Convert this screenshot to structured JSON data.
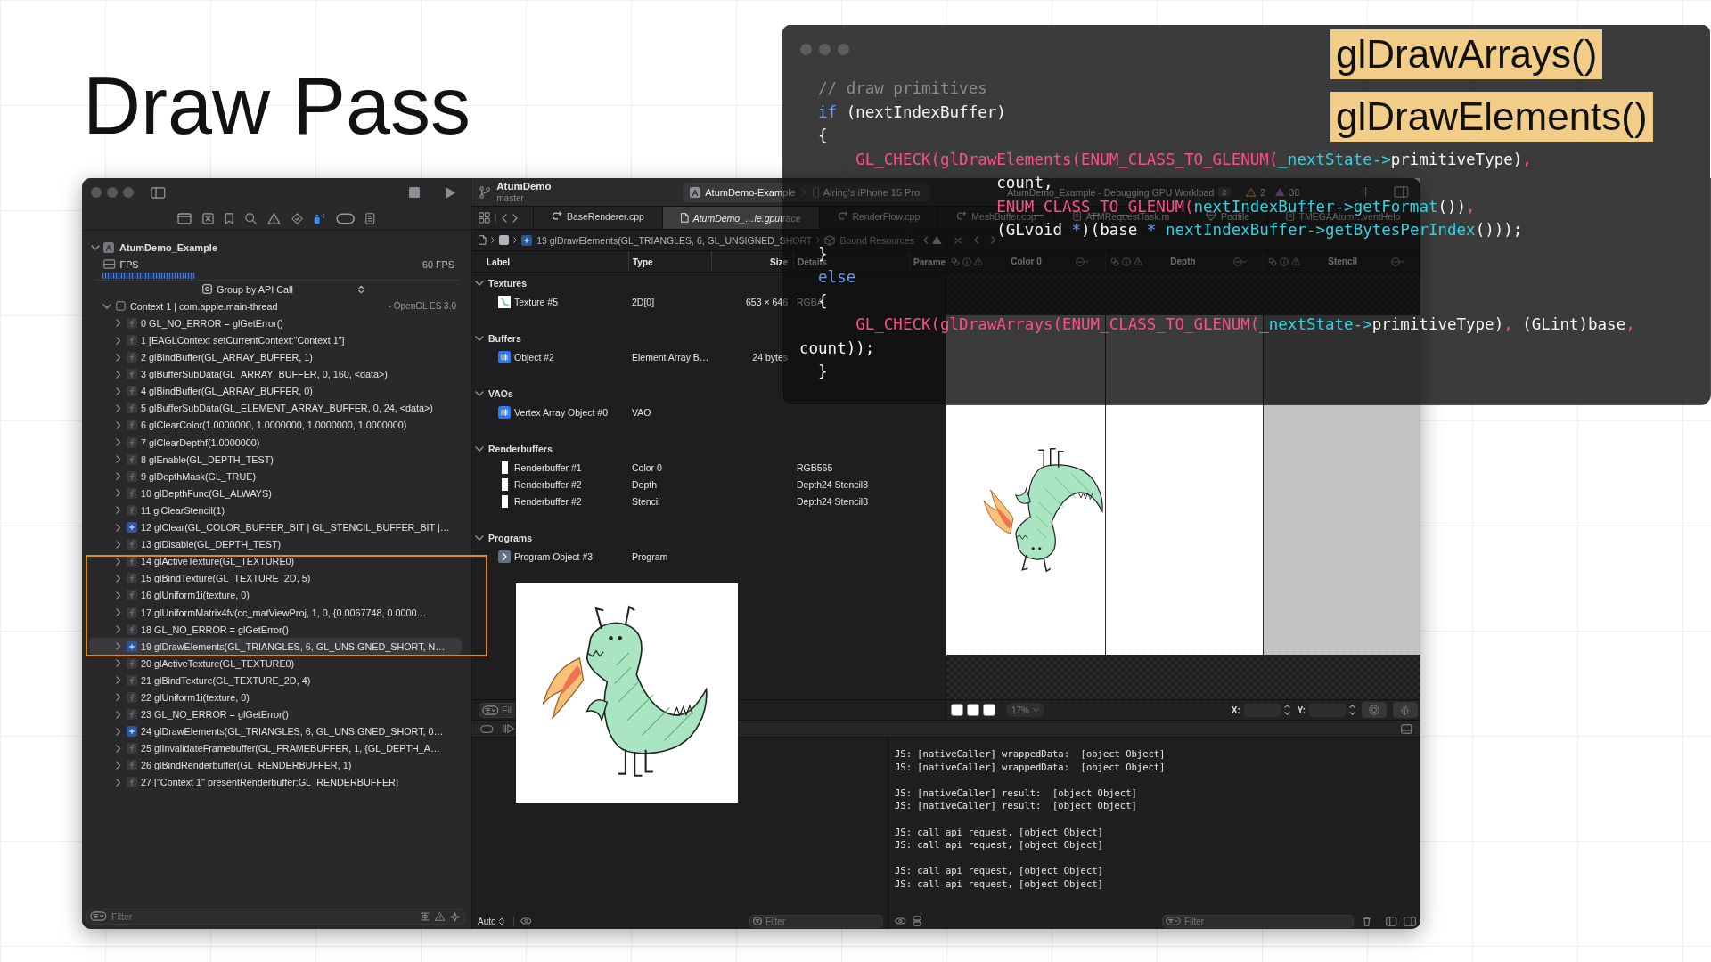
{
  "slide": {
    "title": "Draw Pass"
  },
  "navigator": {
    "toolbar": [
      {
        "kind": "project",
        "selected": false
      },
      {
        "kind": "source",
        "selected": false
      },
      {
        "kind": "bookmark",
        "selected": false
      },
      {
        "kind": "find",
        "selected": false
      },
      {
        "kind": "issue",
        "selected": false
      },
      {
        "kind": "test",
        "selected": false
      },
      {
        "kind": "debug",
        "selected": true
      },
      {
        "kind": "breakpoint",
        "selected": false
      },
      {
        "kind": "report",
        "selected": false
      }
    ],
    "app": {
      "name": "AtumDemo_Example",
      "expanded": true
    },
    "fps": {
      "label": "FPS",
      "value": "60 FPS"
    },
    "grouping": "Group by API Call",
    "context": {
      "name": "Context 1 | com.apple.main-thread",
      "api": "- OpenGL ES 3.0",
      "expanded": true
    },
    "calls": [
      {
        "text": "0 GL_NO_ERROR = glGetError()",
        "kind": "call",
        "expanded": false,
        "selected": false
      },
      {
        "text": "1 [EAGLContext setCurrentContext:\"Context 1\"]",
        "kind": "call",
        "expanded": false,
        "selected": false
      },
      {
        "text": "2 glBindBuffer(GL_ARRAY_BUFFER, 1)",
        "kind": "call",
        "expanded": false,
        "selected": false
      },
      {
        "text": "3 glBufferSubData(GL_ARRAY_BUFFER, 0, 160, <data>)",
        "kind": "call",
        "expanded": false,
        "selected": false
      },
      {
        "text": "4 glBindBuffer(GL_ARRAY_BUFFER, 0)",
        "kind": "call",
        "expanded": false,
        "selected": false
      },
      {
        "text": "5 glBufferSubData(GL_ELEMENT_ARRAY_BUFFER, 0, 24, <data>)",
        "kind": "call",
        "expanded": false,
        "selected": false
      },
      {
        "text": "6 glClearColor(1.0000000, 1.0000000, 1.0000000, 1.0000000)",
        "kind": "call",
        "expanded": false,
        "selected": false
      },
      {
        "text": "7 glClearDepthf(1.0000000)",
        "kind": "call",
        "expanded": false,
        "selected": false
      },
      {
        "text": "8 glEnable(GL_DEPTH_TEST)",
        "kind": "call",
        "expanded": false,
        "selected": false
      },
      {
        "text": "9 glDepthMask(GL_TRUE)",
        "kind": "call",
        "expanded": false,
        "selected": false
      },
      {
        "text": "10 glDepthFunc(GL_ALWAYS)",
        "kind": "call",
        "expanded": false,
        "selected": false
      },
      {
        "text": "11 glClearStencil(1)",
        "kind": "call",
        "expanded": false,
        "selected": false
      },
      {
        "text": "12 glClear(GL_COLOR_BUFFER_BIT | GL_STENCIL_BUFFER_BIT |…",
        "kind": "draw",
        "expanded": false,
        "selected": false
      },
      {
        "text": "13 glDisable(GL_DEPTH_TEST)",
        "kind": "call",
        "expanded": false,
        "selected": false
      },
      {
        "text": "14 glActiveTexture(GL_TEXTURE0)",
        "kind": "call",
        "expanded": false,
        "selected": false
      },
      {
        "text": "15 glBindTexture(GL_TEXTURE_2D, 5)",
        "kind": "call",
        "expanded": false,
        "selected": false
      },
      {
        "text": "16 glUniform1i(texture, 0)",
        "kind": "call",
        "expanded": false,
        "selected": false
      },
      {
        "text": "17 glUniformMatrix4fv(cc_matViewProj, 1, 0, {0.0067748, 0.0000…",
        "kind": "call",
        "expanded": false,
        "selected": false
      },
      {
        "text": "18 GL_NO_ERROR = glGetError()",
        "kind": "call",
        "expanded": false,
        "selected": false
      },
      {
        "text": "19 glDrawElements(GL_TRIANGLES, 6, GL_UNSIGNED_SHORT, N…",
        "kind": "draw",
        "expanded": false,
        "selected": true
      },
      {
        "text": "20 glActiveTexture(GL_TEXTURE0)",
        "kind": "call",
        "expanded": false,
        "selected": false
      },
      {
        "text": "21 glBindTexture(GL_TEXTURE_2D, 4)",
        "kind": "call",
        "expanded": false,
        "selected": false
      },
      {
        "text": "22 glUniform1i(texture, 0)",
        "kind": "call",
        "expanded": false,
        "selected": false
      },
      {
        "text": "23 GL_NO_ERROR = glGetError()",
        "kind": "call",
        "expanded": false,
        "selected": false
      },
      {
        "text": "24 glDrawElements(GL_TRIANGLES, 6, GL_UNSIGNED_SHORT, 0…",
        "kind": "draw",
        "expanded": false,
        "selected": false
      },
      {
        "text": "25 glInvalidateFramebuffer(GL_FRAMEBUFFER, 1, {GL_DEPTH_A…",
        "kind": "call",
        "expanded": false,
        "selected": false
      },
      {
        "text": "26 glBindRenderbuffer(GL_RENDERBUFFER, 1)",
        "kind": "call",
        "expanded": false,
        "selected": false
      },
      {
        "text": "27 [\"Context 1\" presentRenderbuffer:GL_RENDERBUFFER]",
        "kind": "call",
        "expanded": false,
        "selected": false
      }
    ],
    "filter": {
      "placeholder": "Filter"
    }
  },
  "toolbar": {
    "project": "AtumDemo",
    "branch": "master",
    "scheme": "AtumDemo-Example",
    "device": "Airing's iPhone 15 Pro",
    "activity": "AtumDemo_Example - Debugging GPU Workload",
    "activity_count": "2",
    "warnings": "2",
    "issues": "38"
  },
  "tabs": [
    {
      "label": "BaseRenderer.cpp",
      "kind": "cpp",
      "selected": false
    },
    {
      "label": "AtumDemo_…le.gputrace",
      "kind": "trace",
      "selected": true
    },
    {
      "label": "RenderFlow.cpp",
      "kind": "cpp",
      "selected": false
    },
    {
      "label": "MeshBuffer.cpp",
      "kind": "cpp",
      "selected": false
    },
    {
      "label": "ATMRequestTask.m",
      "kind": "objc",
      "selected": false
    },
    {
      "label": "Podfile",
      "kind": "pod",
      "selected": false
    },
    {
      "label": "TMEGAAtum…ventHelp",
      "kind": "header",
      "selected": false
    }
  ],
  "resources": {
    "breadcrumb": [
      {
        "kind": "file"
      },
      {
        "kind": "frame"
      },
      {
        "kind": "draw",
        "text": "19 glDrawElements(GL_TRIANGLES, 6, GL_UNSIGNED_SHORT"
      },
      {
        "kind": "resources",
        "text": "Bound Resources"
      }
    ],
    "columns": [
      "Label",
      "Type",
      "Size",
      "Details",
      "Parame"
    ],
    "sections": [
      {
        "title": "Textures",
        "expanded": true,
        "rows": [
          {
            "kind": "texture",
            "label": "Texture #5",
            "type": "2D[0]",
            "size": "653 × 646",
            "details": "RGBA"
          }
        ]
      },
      {
        "title": "Buffers",
        "expanded": true,
        "rows": [
          {
            "kind": "buffer",
            "label": "Object #2",
            "type": "Element Array B…",
            "size": "24 bytes"
          }
        ]
      },
      {
        "title": "VAOs",
        "expanded": true,
        "rows": [
          {
            "kind": "vao",
            "label": "Vertex Array Object #0",
            "type": "VAO"
          }
        ]
      },
      {
        "title": "Renderbuffers",
        "expanded": true,
        "rows": [
          {
            "kind": "renderbuffer",
            "label": "Renderbuffer #1",
            "type": "Color 0",
            "details": "RGB565"
          },
          {
            "kind": "renderbuffer",
            "label": "Renderbuffer #2",
            "type": "Depth",
            "details": "Depth24 Stencil8"
          },
          {
            "kind": "renderbuffer",
            "label": "Renderbuffer #2",
            "type": "Stencil",
            "details": "Depth24 Stencil8"
          }
        ]
      },
      {
        "title": "Programs",
        "expanded": true,
        "rows": [
          {
            "kind": "program",
            "label": "Program Object #3",
            "type": "Program"
          }
        ]
      }
    ],
    "filter": {
      "placeholder": "Fil"
    }
  },
  "viewer": {
    "attachments": [
      {
        "label": "Color 0",
        "kind": "color"
      },
      {
        "label": "Depth",
        "kind": "depth"
      },
      {
        "label": "Stencil",
        "kind": "stencil"
      }
    ],
    "zoom": "17%",
    "x_label": "X:",
    "y_label": "Y:"
  },
  "variables": {
    "scope": "Auto",
    "filter": {
      "placeholder": "Filter"
    }
  },
  "console": {
    "groups": [
      [
        "JS: [nativeCaller] wrappedData:  [object Object]",
        "JS: [nativeCaller] wrappedData:  [object Object]"
      ],
      [
        "JS: [nativeCaller] result:  [object Object]",
        "JS: [nativeCaller] result:  [object Object]"
      ],
      [
        "JS: call api request, [object Object]",
        "JS: call api request, [object Object]"
      ],
      [
        "JS: call api request, [object Object]",
        "JS: call api request, [object Object]"
      ]
    ],
    "filter": {
      "placeholder": "Filter"
    }
  },
  "code_panel": {
    "lines": [
      [
        {
          "kind": "comment",
          "text": "  // draw primitives"
        }
      ],
      [
        {
          "kind": "keyword",
          "text": "  if"
        },
        {
          "kind": "plain",
          "text": " (nextIndexBuffer)"
        }
      ],
      [
        {
          "kind": "plain",
          "text": "  {"
        }
      ],
      [
        {
          "kind": "macro",
          "text": "      GL_CHECK(glDrawElements(ENUM_CLASS_TO_GLENUM("
        },
        {
          "kind": "member",
          "text": "_nextState->"
        },
        {
          "kind": "plain",
          "text": "primitiveType)"
        },
        {
          "kind": "macro",
          "text": ","
        }
      ],
      [
        {
          "kind": "plain",
          "text": "                     count,"
        }
      ],
      [
        {
          "kind": "macro",
          "text": "                     ENUM_CLASS_TO_GLENUM("
        },
        {
          "kind": "member",
          "text": "nextIndexBuffer->getFormat"
        },
        {
          "kind": "plain",
          "text": "())"
        },
        {
          "kind": "macro",
          "text": ","
        }
      ],
      [
        {
          "kind": "plain",
          "text": "                     (GLvoid "
        },
        {
          "kind": "operator",
          "text": "*"
        },
        {
          "kind": "plain",
          "text": ")(base "
        },
        {
          "kind": "operator",
          "text": "*"
        },
        {
          "kind": "member",
          "text": " nextIndexBuffer->getBytesPerIndex"
        },
        {
          "kind": "plain",
          "text": "()));"
        }
      ],
      [
        {
          "kind": "plain",
          "text": "  }"
        }
      ],
      [
        {
          "kind": "keyword",
          "text": "  else"
        }
      ],
      [
        {
          "kind": "plain",
          "text": "  {"
        }
      ],
      [
        {
          "kind": "macro",
          "text": "      GL_CHECK(glDrawArrays(ENUM_CLASS_TO_GLENUM("
        },
        {
          "kind": "member",
          "text": "_nextState->"
        },
        {
          "kind": "plain",
          "text": "primitiveType)"
        },
        {
          "kind": "macro",
          "text": ","
        },
        {
          "kind": "plain",
          "text": " (GLint)base"
        },
        {
          "kind": "macro",
          "text": ","
        }
      ],
      [
        {
          "kind": "plain",
          "text": "count));"
        }
      ],
      [
        {
          "kind": "plain",
          "text": "  }"
        }
      ]
    ],
    "tags": [
      "glDrawArrays()",
      "glDrawElements()"
    ]
  }
}
